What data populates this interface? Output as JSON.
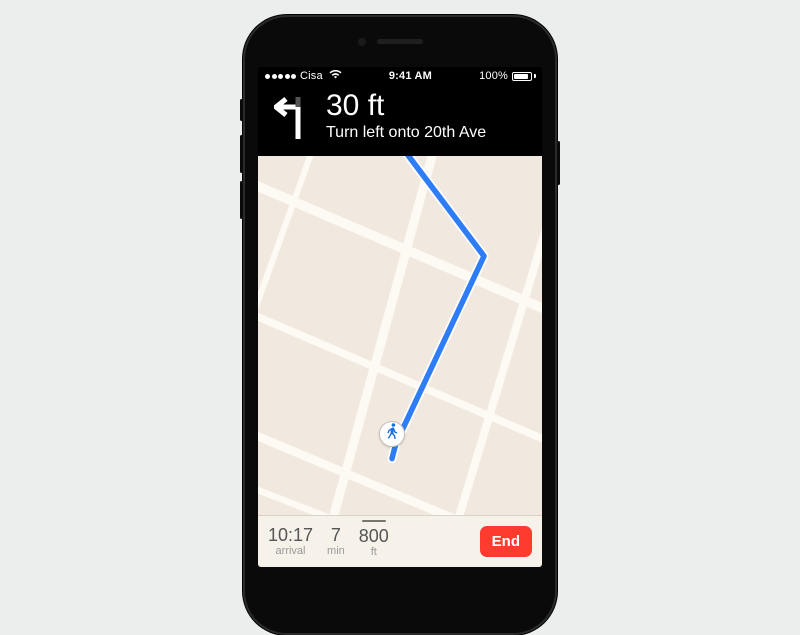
{
  "statusbar": {
    "carrier": "Cisa",
    "time": "9:41 AM",
    "battery_pct": "100%"
  },
  "direction": {
    "distance": "30 ft",
    "instruction": "Turn left onto 20th Ave"
  },
  "bottom": {
    "arrival": {
      "value": "10:17",
      "label": "arrival"
    },
    "duration": {
      "value": "7",
      "label": "min"
    },
    "remaining": {
      "value": "800",
      "label": "ft"
    },
    "end_label": "End"
  },
  "colors": {
    "route": "#2f7df6",
    "end_button": "#ff3b30",
    "map_bg": "#f1e8df"
  }
}
